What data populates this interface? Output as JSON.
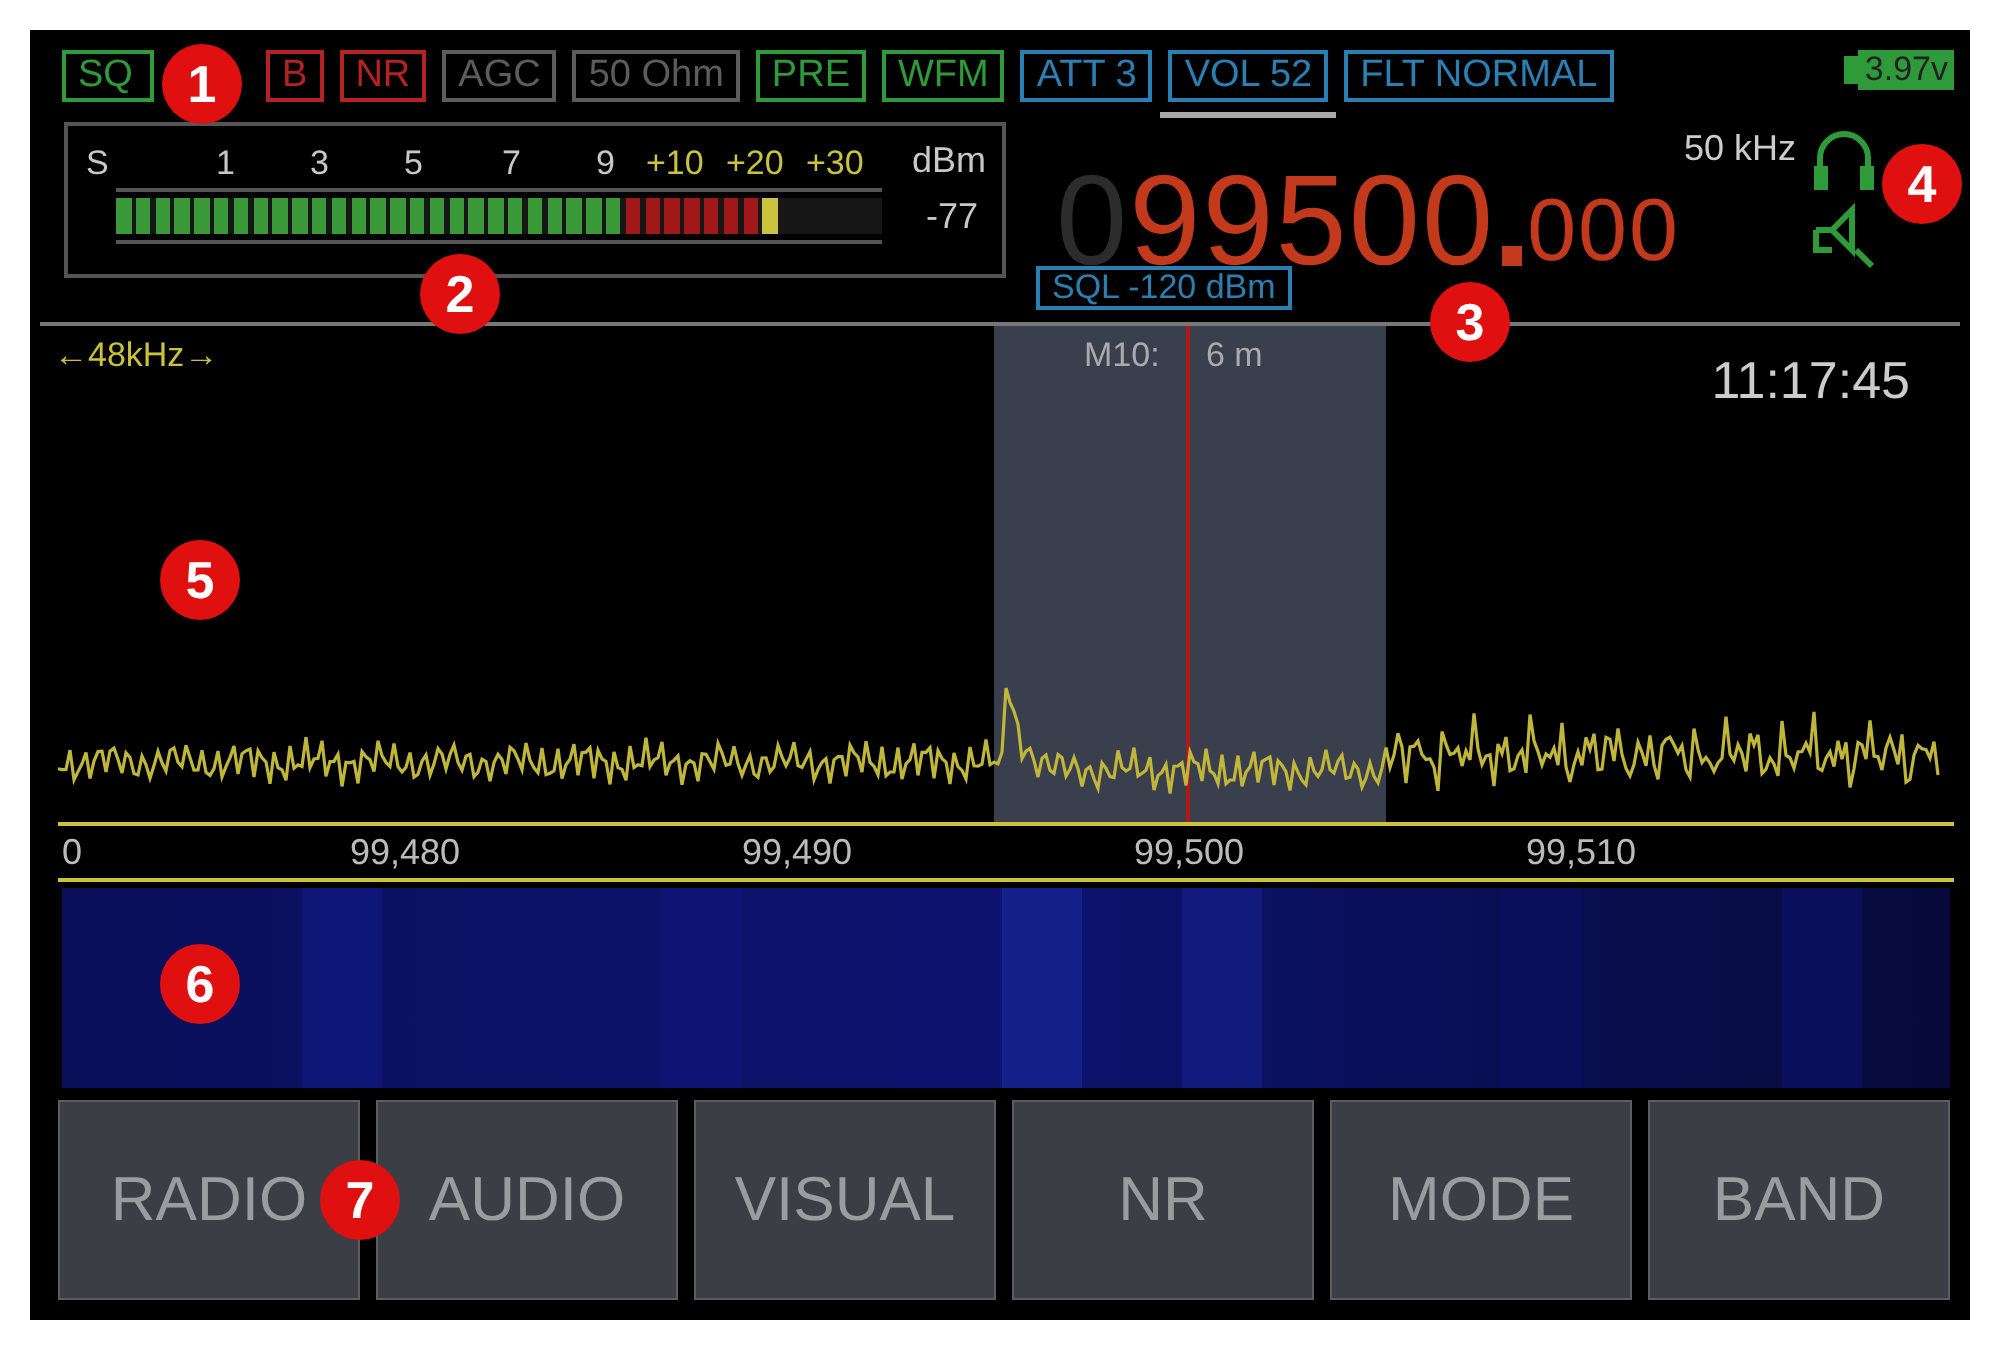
{
  "status_badges": [
    {
      "label": "SQ",
      "color": "#2f9a3a",
      "selected": false
    },
    {
      "label": "B",
      "color": "#b42222",
      "selected": false
    },
    {
      "label": "NR",
      "color": "#b42222",
      "selected": false
    },
    {
      "label": "AGC",
      "color": "#5c5c5c",
      "selected": false
    },
    {
      "label": "50 Ohm",
      "color": "#5c5c5c",
      "selected": false
    },
    {
      "label": "PRE",
      "color": "#2f9a3a",
      "selected": false
    },
    {
      "label": "WFM",
      "color": "#2f9a3a",
      "selected": false
    },
    {
      "label": "ATT 3",
      "color": "#2a7fb3",
      "selected": false
    },
    {
      "label": "VOL 52",
      "color": "#2a7fb3",
      "selected": true
    },
    {
      "label": "FLT NORMAL",
      "color": "#2a7fb3",
      "selected": false
    }
  ],
  "battery": {
    "reading": "3.97v"
  },
  "s_meter": {
    "scale": [
      {
        "label": "S",
        "color": "#c8c8c8"
      },
      {
        "label": "1",
        "color": "#c8c8c8"
      },
      {
        "label": "3",
        "color": "#c8c8c8"
      },
      {
        "label": "5",
        "color": "#c8c8c8"
      },
      {
        "label": "7",
        "color": "#c8c8c8"
      },
      {
        "label": "9",
        "color": "#c8c8c8"
      },
      {
        "label": "+10",
        "color": "#c9c23a"
      },
      {
        "label": "+20",
        "color": "#c9c23a"
      },
      {
        "label": "+30",
        "color": "#c9c23a"
      }
    ],
    "unit": "dBm",
    "reading": "-77"
  },
  "frequency": {
    "leading": "0",
    "main": "99500",
    "decimals": "000",
    "step": "50 kHz",
    "squelch": "SQL -120 dBm"
  },
  "spectrum": {
    "span": "←48kHz→",
    "time": "11:17:45",
    "marker_name": "M10:",
    "marker_value": "6 m",
    "axis_labels": [
      "0",
      "99,480",
      "99,490",
      "99,500",
      "99,510"
    ]
  },
  "buttons": [
    {
      "label": "RADIO"
    },
    {
      "label": "AUDIO"
    },
    {
      "label": "VISUAL"
    },
    {
      "label": "NR"
    },
    {
      "label": "MODE"
    },
    {
      "label": "BAND"
    }
  ],
  "callouts": [
    "1",
    "2",
    "3",
    "4",
    "5",
    "6",
    "7"
  ]
}
